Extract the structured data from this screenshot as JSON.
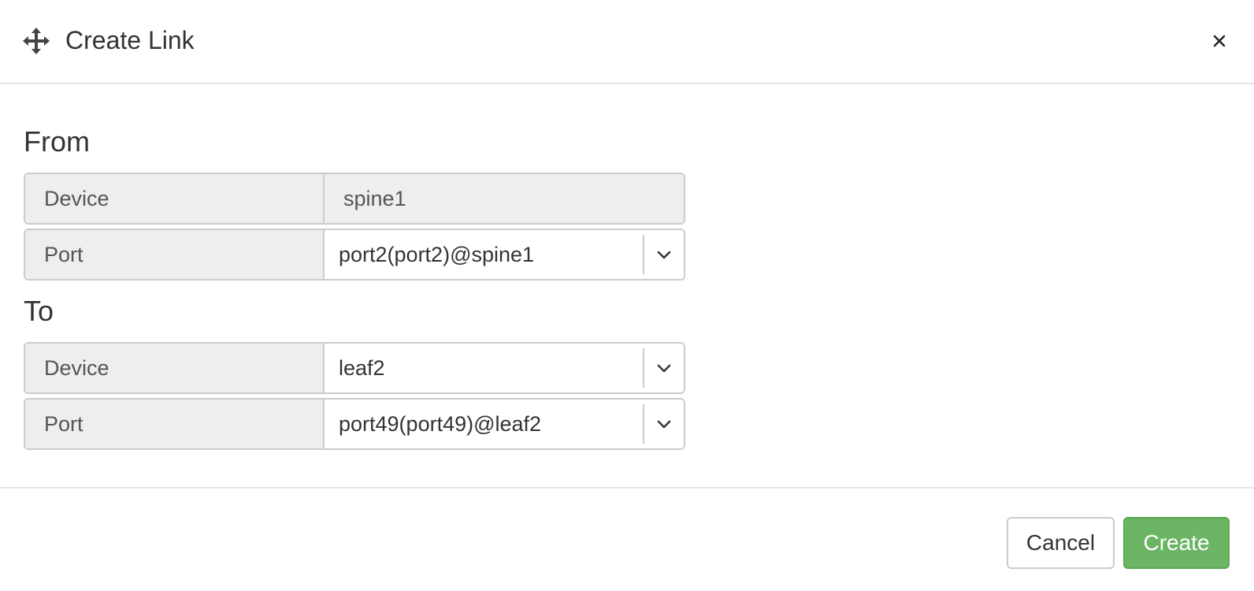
{
  "dialog": {
    "title": "Create Link",
    "close_label": "×"
  },
  "from": {
    "heading": "From",
    "device": {
      "label": "Device",
      "value": "spine1"
    },
    "port": {
      "label": "Port",
      "value": "port2(port2)@spine1"
    }
  },
  "to": {
    "heading": "To",
    "device": {
      "label": "Device",
      "value": "leaf2"
    },
    "port": {
      "label": "Port",
      "value": "port49(port49)@leaf2"
    }
  },
  "footer": {
    "cancel_label": "Cancel",
    "create_label": "Create"
  },
  "colors": {
    "primary_create": "#6cb565",
    "addon_bg": "#eeeeee",
    "border": "#cccccc"
  },
  "icons": {
    "move": "move-icon",
    "close": "close-icon",
    "chevron": "chevron-down-icon"
  }
}
